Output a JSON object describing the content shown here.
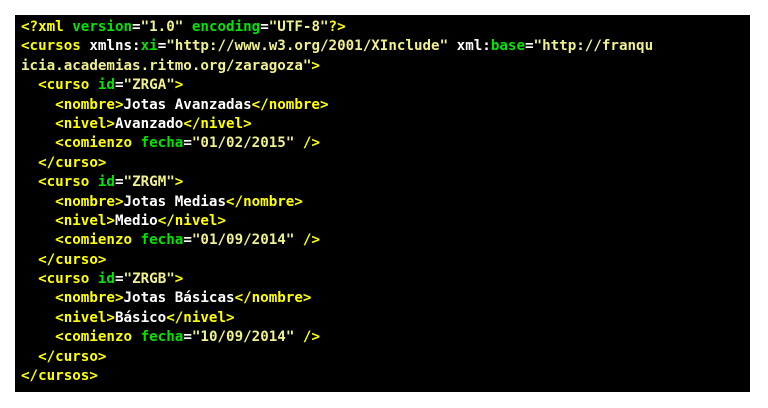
{
  "colors": {
    "background": "#000000",
    "page": "#ffffff",
    "tag": "#ffff00",
    "attribute": "#00e600",
    "string": "#f0f08c",
    "text": "#ffffff"
  },
  "code": {
    "lines": [
      [
        [
          "t",
          "<?xml "
        ],
        [
          "a",
          "version"
        ],
        [
          "p",
          "="
        ],
        [
          "s",
          "\"1.0\""
        ],
        [
          "p",
          " "
        ],
        [
          "a",
          "encoding"
        ],
        [
          "p",
          "="
        ],
        [
          "s",
          "\"UTF-8\""
        ],
        [
          "t",
          "?>"
        ]
      ],
      [
        [
          "t",
          "<cursos "
        ],
        [
          "p",
          "xmlns:"
        ],
        [
          "a",
          "xi"
        ],
        [
          "p",
          "="
        ],
        [
          "s",
          "\"http://www.w3.org/2001/XInclude\""
        ],
        [
          "p",
          " xml:"
        ],
        [
          "a",
          "base"
        ],
        [
          "p",
          "="
        ],
        [
          "s",
          "\"http://franqu"
        ]
      ],
      [
        [
          "s",
          "icia.academias.ritmo.org/zaragoza\""
        ],
        [
          "t",
          ">"
        ]
      ],
      [
        [
          "p",
          "  "
        ],
        [
          "t",
          "<curso "
        ],
        [
          "a",
          "id"
        ],
        [
          "p",
          "="
        ],
        [
          "s",
          "\"ZRGA\""
        ],
        [
          "t",
          ">"
        ]
      ],
      [
        [
          "p",
          "    "
        ],
        [
          "t",
          "<nombre>"
        ],
        [
          "p",
          "Jotas Avanzadas"
        ],
        [
          "t",
          "</nombre>"
        ]
      ],
      [
        [
          "p",
          "    "
        ],
        [
          "t",
          "<nivel>"
        ],
        [
          "p",
          "Avanzado"
        ],
        [
          "t",
          "</nivel>"
        ]
      ],
      [
        [
          "p",
          "    "
        ],
        [
          "t",
          "<comienzo "
        ],
        [
          "a",
          "fecha"
        ],
        [
          "p",
          "="
        ],
        [
          "s",
          "\"01/02/2015\""
        ],
        [
          "t",
          " />"
        ]
      ],
      [
        [
          "p",
          "  "
        ],
        [
          "t",
          "</curso>"
        ]
      ],
      [
        [
          "p",
          "  "
        ],
        [
          "t",
          "<curso "
        ],
        [
          "a",
          "id"
        ],
        [
          "p",
          "="
        ],
        [
          "s",
          "\"ZRGM\""
        ],
        [
          "t",
          ">"
        ]
      ],
      [
        [
          "p",
          "    "
        ],
        [
          "t",
          "<nombre>"
        ],
        [
          "p",
          "Jotas Medias"
        ],
        [
          "t",
          "</nombre>"
        ]
      ],
      [
        [
          "p",
          "    "
        ],
        [
          "t",
          "<nivel>"
        ],
        [
          "p",
          "Medio"
        ],
        [
          "t",
          "</nivel>"
        ]
      ],
      [
        [
          "p",
          "    "
        ],
        [
          "t",
          "<comienzo "
        ],
        [
          "a",
          "fecha"
        ],
        [
          "p",
          "="
        ],
        [
          "s",
          "\"01/09/2014\""
        ],
        [
          "t",
          " />"
        ]
      ],
      [
        [
          "p",
          "  "
        ],
        [
          "t",
          "</curso>"
        ]
      ],
      [
        [
          "p",
          "  "
        ],
        [
          "t",
          "<curso "
        ],
        [
          "a",
          "id"
        ],
        [
          "p",
          "="
        ],
        [
          "s",
          "\"ZRGB\""
        ],
        [
          "t",
          ">"
        ]
      ],
      [
        [
          "p",
          "    "
        ],
        [
          "t",
          "<nombre>"
        ],
        [
          "p",
          "Jotas Básicas"
        ],
        [
          "t",
          "</nombre>"
        ]
      ],
      [
        [
          "p",
          "    "
        ],
        [
          "t",
          "<nivel>"
        ],
        [
          "p",
          "Básico"
        ],
        [
          "t",
          "</nivel>"
        ]
      ],
      [
        [
          "p",
          "    "
        ],
        [
          "t",
          "<comienzo "
        ],
        [
          "a",
          "fecha"
        ],
        [
          "p",
          "="
        ],
        [
          "s",
          "\"10/09/2014\""
        ],
        [
          "t",
          " />"
        ]
      ],
      [
        [
          "p",
          "  "
        ],
        [
          "t",
          "</curso>"
        ]
      ],
      [
        [
          "t",
          "</cursos>"
        ]
      ]
    ]
  }
}
